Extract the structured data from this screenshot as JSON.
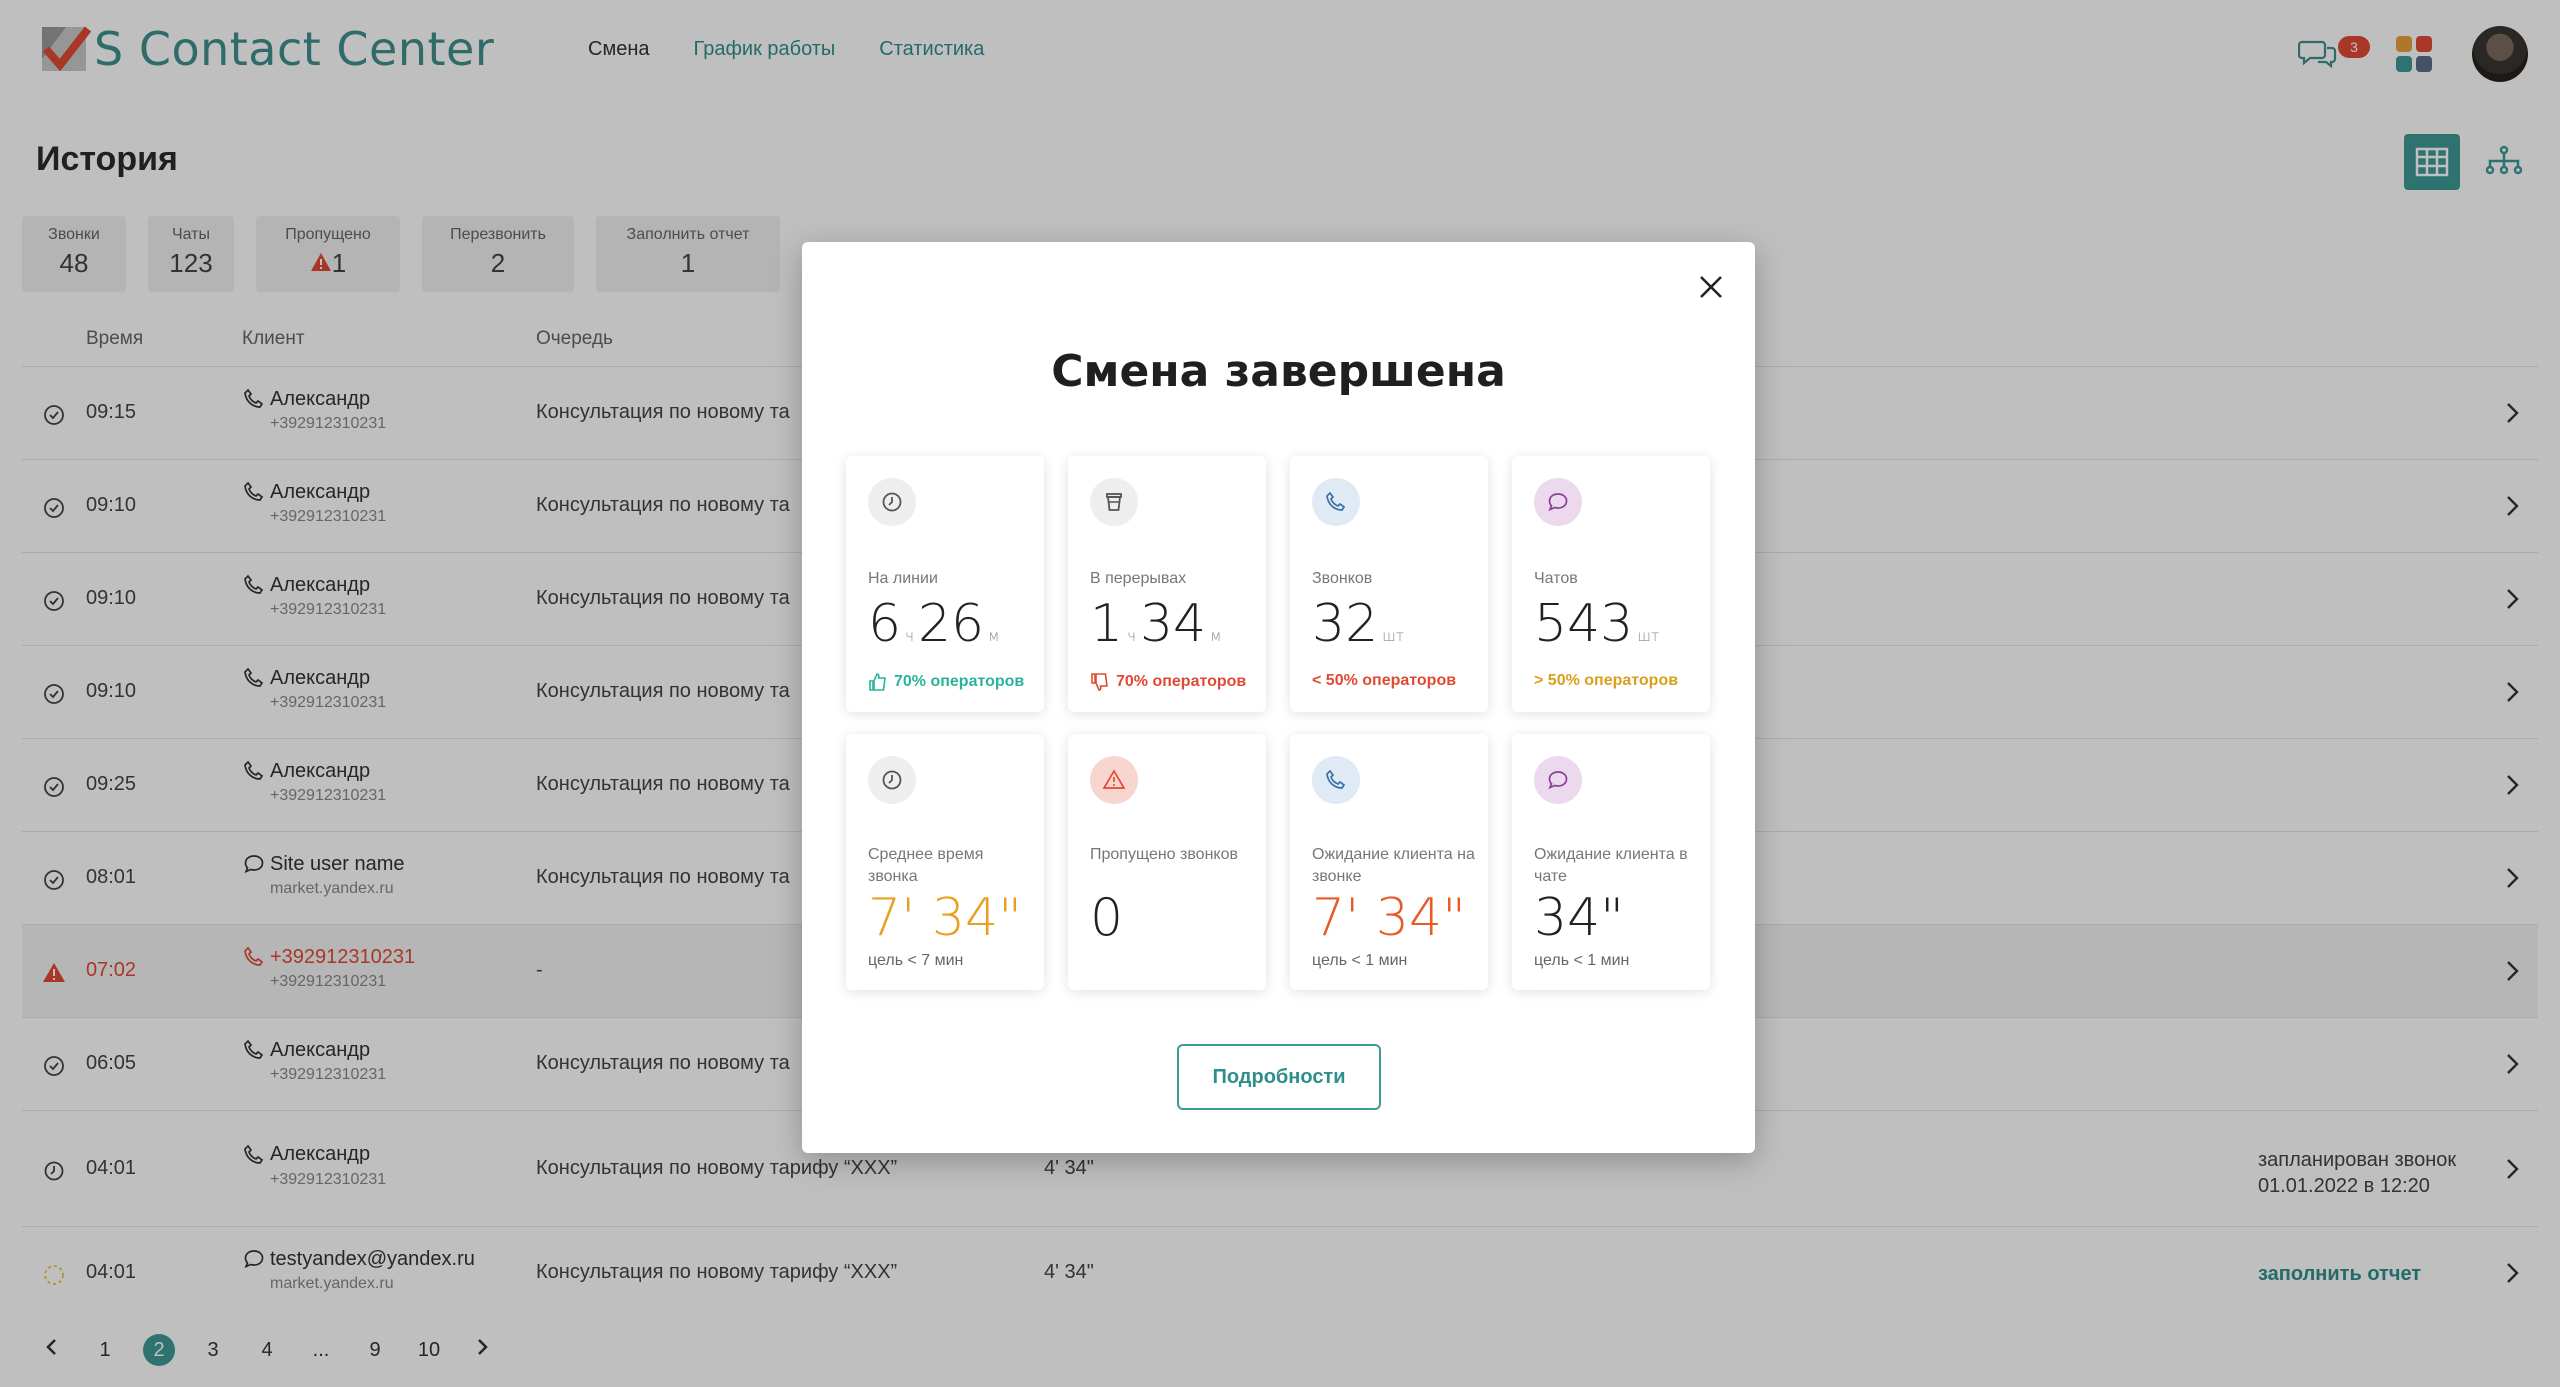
{
  "app": {
    "title": "S Contact Center"
  },
  "nav": {
    "items": [
      "Смена",
      "График работы",
      "Статистика"
    ]
  },
  "header": {
    "chat_badge": "3"
  },
  "history": {
    "title": "История",
    "stats": [
      {
        "label": "Звонки",
        "value": "48"
      },
      {
        "label": "Чаты",
        "value": "123"
      },
      {
        "label": "Пропущено",
        "value": "1"
      },
      {
        "label": "Перезвонить",
        "value": "2"
      },
      {
        "label": "Заполнить отчет",
        "value": "1"
      }
    ],
    "columns": {
      "time": "Время",
      "client": "Клиент",
      "queue": "Очередь"
    },
    "rows": [
      {
        "status": "done",
        "time": "09:15",
        "type": "phone",
        "name": "Александр",
        "sub": "+392912310231",
        "queue": "Консультация по новому та",
        "duration": "",
        "note": ""
      },
      {
        "status": "done",
        "time": "09:10",
        "type": "phone",
        "name": "Александр",
        "sub": "+392912310231",
        "queue": "Консультация по новому та",
        "duration": "",
        "note": ""
      },
      {
        "status": "done",
        "time": "09:10",
        "type": "phone",
        "name": "Александр",
        "sub": "+392912310231",
        "queue": "Консультация по новому та",
        "duration": "",
        "note": ""
      },
      {
        "status": "done",
        "time": "09:10",
        "type": "phone",
        "name": "Александр",
        "sub": "+392912310231",
        "queue": "Консультация по новому та",
        "duration": "",
        "note": ""
      },
      {
        "status": "done",
        "time": "09:25",
        "type": "phone",
        "name": "Александр",
        "sub": "+392912310231",
        "queue": "Консультация по новому та",
        "duration": "",
        "note": ""
      },
      {
        "status": "done",
        "time": "08:01",
        "type": "chat",
        "name": "Site user name",
        "sub": "market.yandex.ru",
        "queue": "Консультация по новому та",
        "duration": "",
        "note": ""
      },
      {
        "status": "missed",
        "time": "07:02",
        "type": "missed",
        "name": "+392912310231",
        "sub": "+392912310231",
        "queue": "-",
        "duration": "",
        "note": ""
      },
      {
        "status": "done",
        "time": "06:05",
        "type": "phone",
        "name": "Александр",
        "sub": "+392912310231",
        "queue": "Консультация по новому та",
        "duration": "",
        "note": ""
      },
      {
        "status": "scheduled",
        "time": "04:01",
        "type": "phone",
        "name": "Александр",
        "sub": "+392912310231",
        "queue": "Консультация по новому тарифу “ХХХ”",
        "duration": "4' 34\"",
        "note": "запланирован звонок\n01.01.2022 в 12:20"
      },
      {
        "status": "pending",
        "time": "04:01",
        "type": "chat",
        "name": "testyandex@yandex.ru",
        "sub": "market.yandex.ru",
        "queue": "Консультация по новому тарифу “ХХХ”",
        "duration": "4' 34\"",
        "note": "заполнить отчет"
      }
    ],
    "pagination": [
      "1",
      "2",
      "3",
      "4",
      "...",
      "9",
      "10"
    ],
    "current_page": "2"
  },
  "modal": {
    "title": "Смена завершена",
    "cards": [
      {
        "icon": "clock-icon",
        "label": "На линии",
        "v1": "6",
        "u1": "ч",
        "v2": "26",
        "u2": "м",
        "foot": "70% операторов",
        "foot_icon": "thumbs-up-icon",
        "foot_color": "#2bb39a",
        "icon_bg": "#eeeeee"
      },
      {
        "icon": "coffee-cup-icon",
        "label": "В перерывах",
        "v1": "1",
        "u1": "ч",
        "v2": "34",
        "u2": "м",
        "foot": "70% операторов",
        "foot_icon": "thumbs-down-icon",
        "foot_color": "#e04a35",
        "icon_bg": "#eeeeee"
      },
      {
        "icon": "phone-icon",
        "label": "Звонков",
        "v1": "32",
        "u1": "шт",
        "v2": "",
        "u2": "",
        "foot": "< 50% операторов",
        "foot_icon": "",
        "foot_color": "#e04a35",
        "icon_bg": "#dfeaf5"
      },
      {
        "icon": "chat-bubble-icon",
        "label": "Чатов",
        "v1": "543",
        "u1": "шт",
        "v2": "",
        "u2": "",
        "foot": "> 50% операторов",
        "foot_icon": "",
        "foot_color": "#d9a01c",
        "icon_bg": "#ecd9ee"
      }
    ],
    "cards2": [
      {
        "icon": "clock-icon",
        "label": "Среднее время звонка",
        "value": "7' 34\"",
        "color": "#e8a021",
        "foot": "цель < 7 мин",
        "icon_bg": "#eeeeee"
      },
      {
        "icon": "warning-icon",
        "label": "Пропущено звонков",
        "value": "0",
        "color": "#222222",
        "foot": "",
        "icon_bg": "#f8d6cf"
      },
      {
        "icon": "phone-icon",
        "label": "Ожидание клиента на звонке",
        "value": "7' 34\"",
        "color": "#e85a28",
        "foot": "цель < 1 мин",
        "icon_bg": "#dfeaf5"
      },
      {
        "icon": "chat-bubble-icon",
        "label": "Ожидание клиента в чате",
        "value": "34\"",
        "color": "#222222",
        "foot": "цель < 1 мин",
        "icon_bg": "#ecd9ee"
      }
    ],
    "details_button": "Подробности"
  },
  "colors": {
    "accent": "#3e9a96",
    "danger": "#e04a35",
    "warning": "#e8a021"
  }
}
